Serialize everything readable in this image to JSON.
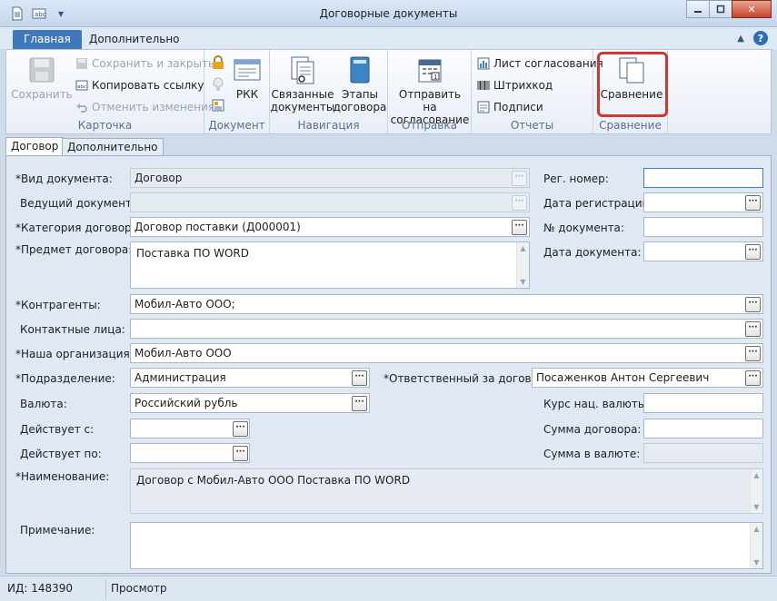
{
  "window": {
    "title": "Договорные документы"
  },
  "ribbon_tabs": {
    "main": "Главная",
    "extra": "Дополнительно"
  },
  "ribbon": {
    "card": {
      "label": "Карточка",
      "save": "Сохранить",
      "save_close": "Сохранить и закрыть",
      "copy_link": "Копировать ссылку",
      "cancel_changes": "Отменить изменения"
    },
    "document": {
      "label": "Документ",
      "rkk": "РКК"
    },
    "navigation": {
      "label": "Навигация",
      "linked_1": "Связанные",
      "linked_2": "документы",
      "stages_1": "Этапы",
      "stages_2": "договора"
    },
    "sending": {
      "label": "Отправка",
      "send_1": "Отправить на",
      "send_2": "согласование"
    },
    "reports": {
      "label": "Отчеты",
      "approval_sheet": "Лист согласования",
      "barcode": "Штрихкод",
      "signatures": "Подписи"
    },
    "compare": {
      "label": "Сравнение",
      "button": "Сравнение"
    }
  },
  "form_tabs": {
    "contract": "Договор",
    "extra": "Дополнительно"
  },
  "form": {
    "doc_type_label": "*Вид документа:",
    "doc_type": "Договор",
    "lead_doc_label": "Ведущий документ:",
    "lead_doc": "",
    "category_label": "*Категория договора:",
    "category": "Договор поставки (Д000001)",
    "subject_label": "*Предмет договора:",
    "subject": "Поставка ПО WORD",
    "counterparties_label": "*Контрагенты:",
    "counterparties": "Мобил-Авто ООО;",
    "contacts_label": "Контактные лица:",
    "contacts": "",
    "our_org_label": "*Наша организация:",
    "our_org": "Мобил-Авто ООО",
    "department_label": "*Подразделение:",
    "department": "Администрация",
    "responsible_label": "*Ответственный за договор:",
    "responsible": "Посаженков Антон Сергеевич",
    "currency_label": "Валюта:",
    "currency": "Российский рубль",
    "valid_from_label": "Действует с:",
    "valid_from": "",
    "valid_to_label": "Действует по:",
    "valid_to": "",
    "reg_number_label": "Рег. номер:",
    "reg_number": "",
    "reg_date_label": "Дата регистрации:",
    "reg_date": "",
    "doc_number_label": "№ документа:",
    "doc_number": "",
    "doc_date_label": "Дата документа:",
    "doc_date": "",
    "rate_label": "Курс нац. валюты:",
    "rate": "",
    "amount_label": "Сумма договора:",
    "amount": "",
    "amount_cur_label": "Сумма в валюте:",
    "amount_cur": "",
    "name_label": "*Наименование:",
    "name": "Договор с Мобил-Авто ООО Поставка ПО WORD",
    "note_label": "Примечание:",
    "note": ""
  },
  "status": {
    "id": "ИД: 148390",
    "mode": "Просмотр"
  }
}
